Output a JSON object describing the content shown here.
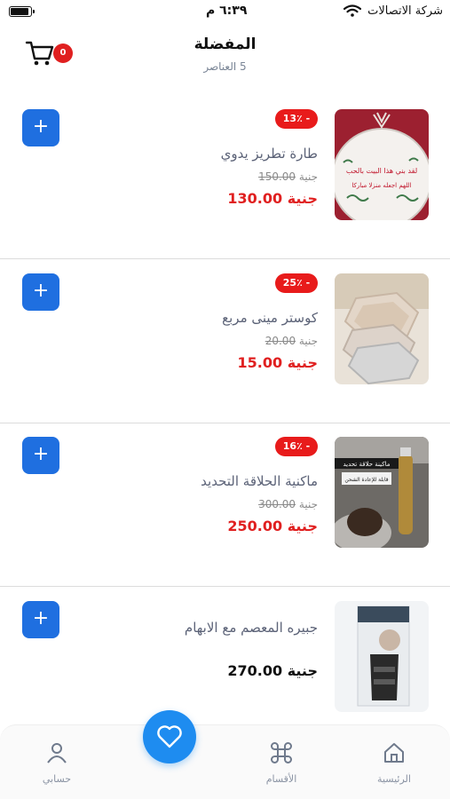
{
  "status_bar": {
    "carrier": "شركة الاتصالات",
    "time": "٦:٣٩ م",
    "battery_level": 0.9
  },
  "header": {
    "title": "المفضلة",
    "count_label": "5  العناصر",
    "cart_count": "0",
    "cart_icon": "cart-icon"
  },
  "products": [
    {
      "name": "طارة تطريز يدوي",
      "discount": "13٪ -",
      "old_currency": "جنية",
      "old_price": "150.00",
      "price": "جنية 130.00",
      "image_text_1": "لقد بني هذا البيت بالحب",
      "image_text_2": "اللهم اجعله منزلا مباركا"
    },
    {
      "name": "كوستر مينى مربع",
      "discount": "25٪ -",
      "old_currency": "جنية",
      "old_price": "20.00",
      "price": "جنية 15.00"
    },
    {
      "name": "ماكنية الحلاقة التحديد",
      "discount": "16٪ -",
      "old_currency": "جنية",
      "old_price": "300.00",
      "price": "جنية 250.00",
      "image_text_1": "ماكينة حلاقة تحديد",
      "image_text_2": "قابلة للإعادة الشحن"
    },
    {
      "name": "جبيره المعصم مع الابهام",
      "price": "جنية 270.00"
    }
  ],
  "add_label": "+",
  "bottom_nav": {
    "home": {
      "label": "الرئيسية",
      "icon": "home-icon"
    },
    "categories": {
      "label": "الأقسام",
      "icon": "command-icon"
    },
    "favorites": {
      "icon": "heart-icon"
    },
    "account": {
      "label": "حسابي",
      "icon": "user-icon"
    }
  },
  "colors": {
    "accent": "#1e8cf0",
    "add_button": "#1f6fe0",
    "sale": "#e02020"
  }
}
